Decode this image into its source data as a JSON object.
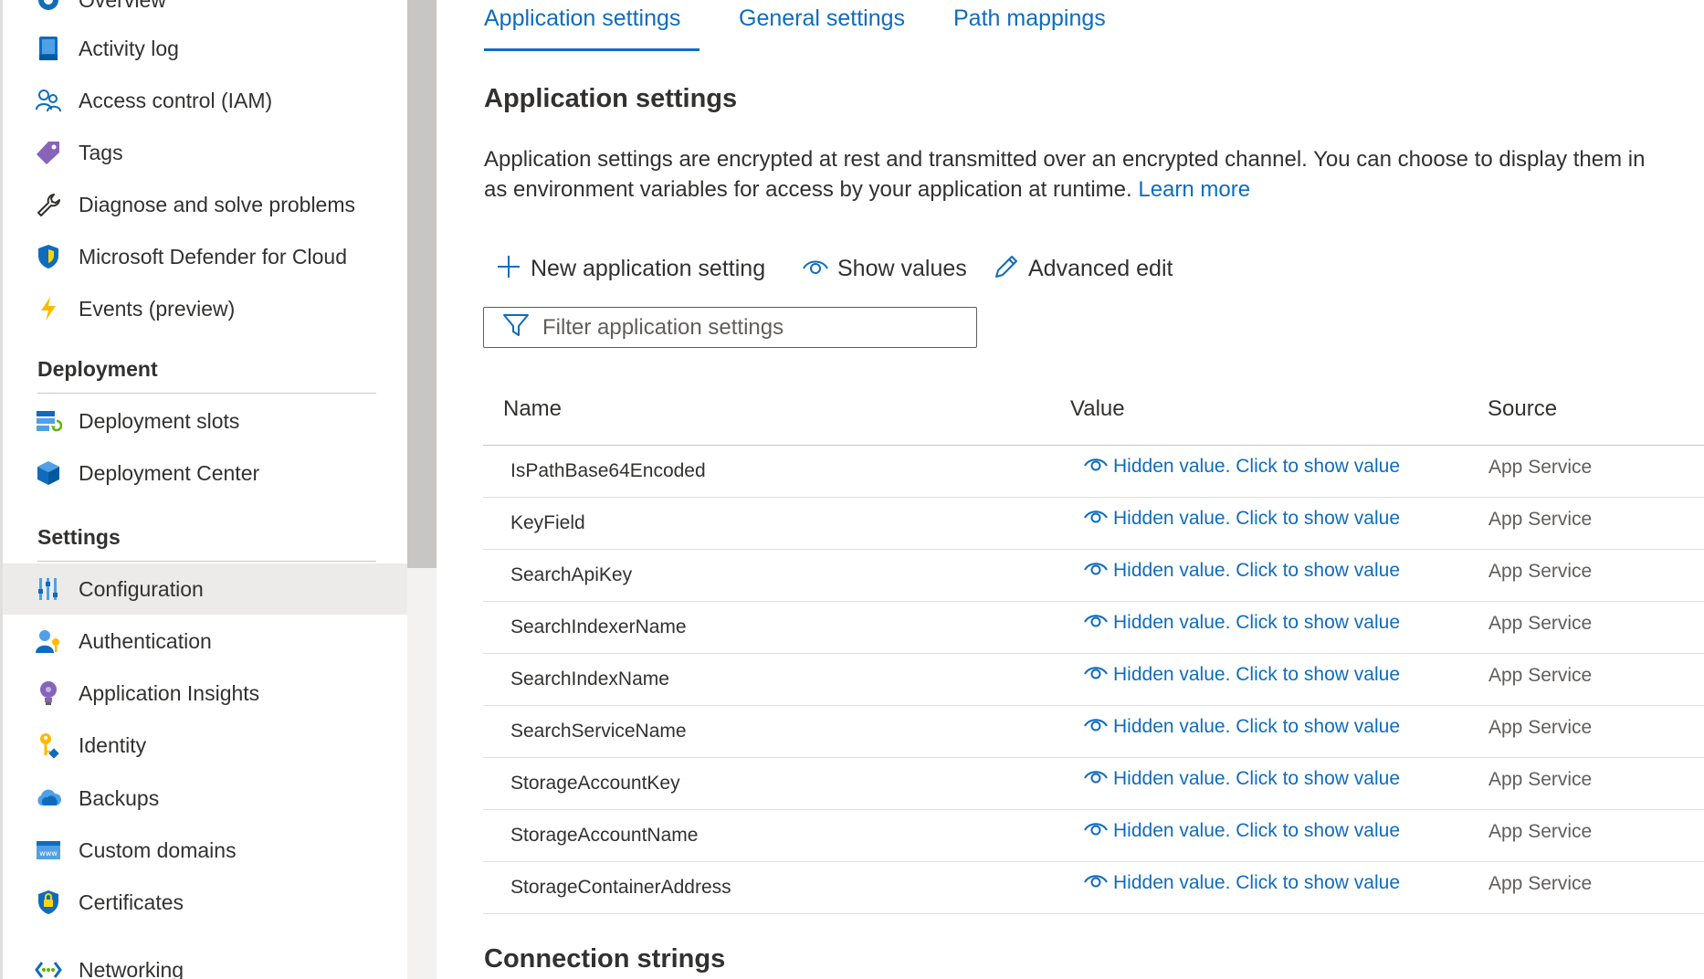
{
  "sidebar": {
    "items_top": [
      {
        "label": "Overview",
        "icon": "overview-icon"
      },
      {
        "label": "Activity log",
        "icon": "activity-log-icon"
      },
      {
        "label": "Access control (IAM)",
        "icon": "people-icon"
      },
      {
        "label": "Tags",
        "icon": "tag-icon"
      },
      {
        "label": "Diagnose and solve problems",
        "icon": "wrench-icon"
      },
      {
        "label": "Microsoft Defender for Cloud",
        "icon": "shield-icon"
      },
      {
        "label": "Events (preview)",
        "icon": "lightning-icon"
      }
    ],
    "deployment_title": "Deployment",
    "deployment_items": [
      {
        "label": "Deployment slots",
        "icon": "deployment-slots-icon"
      },
      {
        "label": "Deployment Center",
        "icon": "cube-icon"
      }
    ],
    "settings_title": "Settings",
    "settings_items": [
      {
        "label": "Configuration",
        "icon": "configuration-sliders-icon",
        "active": true
      },
      {
        "label": "Authentication",
        "icon": "person-key-icon"
      },
      {
        "label": "Application Insights",
        "icon": "lightbulb-icon"
      },
      {
        "label": "Identity",
        "icon": "key-icon"
      },
      {
        "label": "Backups",
        "icon": "cloud-icon"
      },
      {
        "label": "Custom domains",
        "icon": "www-icon"
      },
      {
        "label": "Certificates",
        "icon": "certificate-shield-icon"
      },
      {
        "label": "Networking",
        "icon": "network-icon"
      }
    ]
  },
  "tabs": [
    {
      "label": "Application settings",
      "active": true
    },
    {
      "label": "General settings"
    },
    {
      "label": "Path mappings"
    }
  ],
  "section_title": "Application settings",
  "description": {
    "line1": "Application settings are encrypted at rest and transmitted over an encrypted channel. You can choose to display them in",
    "line2": "as environment variables for access by your application at runtime.",
    "link": "Learn more"
  },
  "commands": {
    "new": "New application setting",
    "show": "Show values",
    "advanced": "Advanced edit"
  },
  "filter": {
    "placeholder": "Filter application settings",
    "value": ""
  },
  "table": {
    "headers": {
      "name": "Name",
      "value": "Value",
      "source": "Source"
    },
    "rows": [
      {
        "name": "IsPathBase64Encoded",
        "value": "Hidden value. Click to show value",
        "source": "App Service"
      },
      {
        "name": "KeyField",
        "value": "Hidden value. Click to show value",
        "source": "App Service"
      },
      {
        "name": "SearchApiKey",
        "value": "Hidden value. Click to show value",
        "source": "App Service"
      },
      {
        "name": "SearchIndexerName",
        "value": "Hidden value. Click to show value",
        "source": "App Service"
      },
      {
        "name": "SearchIndexName",
        "value": "Hidden value. Click to show value",
        "source": "App Service"
      },
      {
        "name": "SearchServiceName",
        "value": "Hidden value. Click to show value",
        "source": "App Service"
      },
      {
        "name": "StorageAccountKey",
        "value": "Hidden value. Click to show value",
        "source": "App Service"
      },
      {
        "name": "StorageAccountName",
        "value": "Hidden value. Click to show value",
        "source": "App Service"
      },
      {
        "name": "StorageContainerAddress",
        "value": "Hidden value. Click to show value",
        "source": "App Service"
      }
    ]
  },
  "connection_strings_title": "Connection strings",
  "colors": {
    "accent": "#0f6cbd",
    "active_nav_bg": "#edebe9",
    "text": "#323130",
    "muted": "#605e5c"
  }
}
